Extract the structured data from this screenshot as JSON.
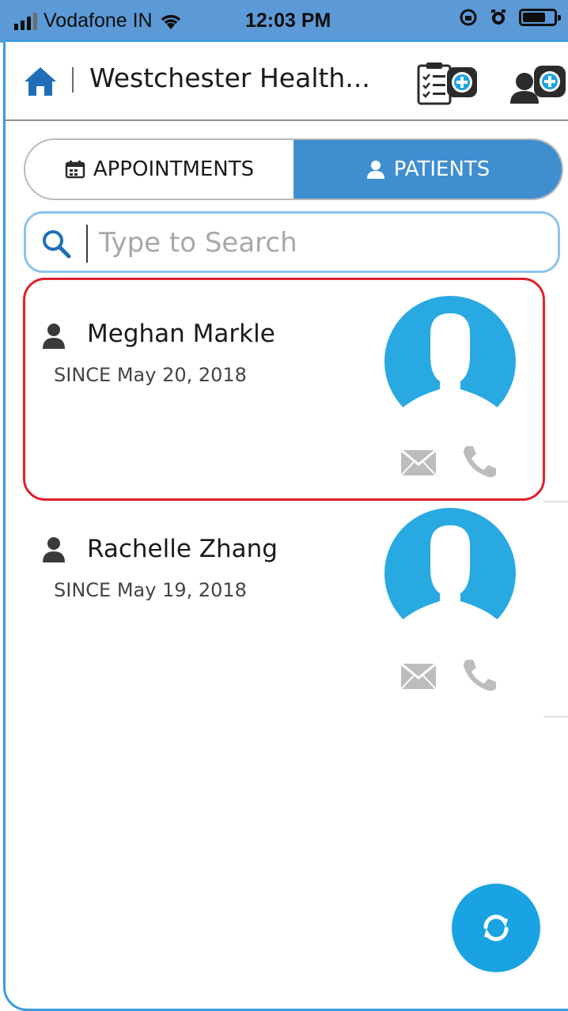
{
  "status_bar": {
    "carrier": "Vodafone IN",
    "time": "12:03 PM",
    "icons": [
      "signal-icon",
      "wifi-icon",
      "rotation-lock-icon",
      "alarm-icon",
      "battery-icon"
    ]
  },
  "header": {
    "title": "Westchester Health...",
    "icons": [
      "home-icon",
      "add-appointment-icon",
      "add-patient-icon"
    ]
  },
  "tabs": [
    {
      "label": "APPOINTMENTS",
      "icon": "calendar-icon",
      "selected": false
    },
    {
      "label": "PATIENTS",
      "icon": "person-icon",
      "selected": true
    }
  ],
  "search": {
    "placeholder": "Type to Search",
    "value": ""
  },
  "patients": [
    {
      "name": "Meghan Markle",
      "since": "SINCE May 20, 2018",
      "selected": true
    },
    {
      "name": "Rachelle Zhang",
      "since": "SINCE May 19, 2018",
      "selected": false
    }
  ],
  "colors": {
    "status_bar": "#5b9ad6",
    "frame_border": "#3b9de0",
    "tab_active": "#3f8fd0",
    "avatar": "#29a9e1",
    "selection_border": "#e0202a",
    "fab": "#1aa3e2",
    "contact_icons": "#bdbdbd"
  }
}
